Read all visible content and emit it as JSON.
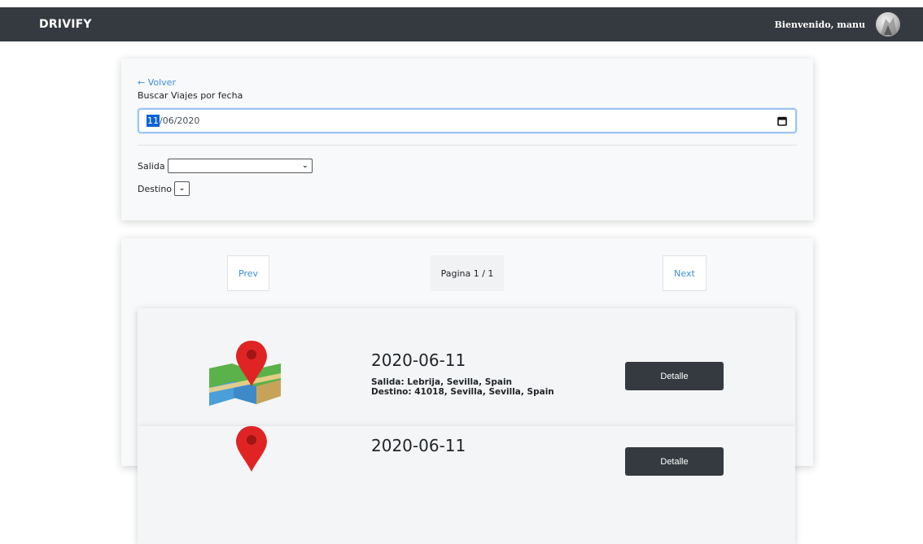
{
  "navbar": {
    "brand": "DRIVIFY",
    "welcome": "Bienvenido, manu"
  },
  "search": {
    "back_link": "← Volver",
    "label": "Buscar Viajes por fecha",
    "date_day": "11",
    "date_rest": "/06/2020",
    "salida_label": "Salida",
    "salida_value": "",
    "destino_label": "Destino",
    "destino_value": ""
  },
  "pagination": {
    "prev": "Prev",
    "info": "Pagina 1 / 1",
    "next": "Next"
  },
  "trips": [
    {
      "date": "2020-06-11",
      "salida": "Salida: Lebrija, Sevilla, Spain",
      "destino": "Destino: 41018, Sevilla, Sevilla, Spain",
      "button": "Detalle"
    },
    {
      "date": "2020-06-11",
      "salida": "",
      "destino": "",
      "button": "Detalle"
    }
  ],
  "icons": {
    "calendar": "calendar-icon",
    "chevron": "chevron-down-icon",
    "map": "map-pin-icon"
  },
  "colors": {
    "navbar_bg": "#343a40",
    "link": "#3b8ed8",
    "button_dark": "#343a40",
    "card_bg": "#f8f9fa"
  }
}
